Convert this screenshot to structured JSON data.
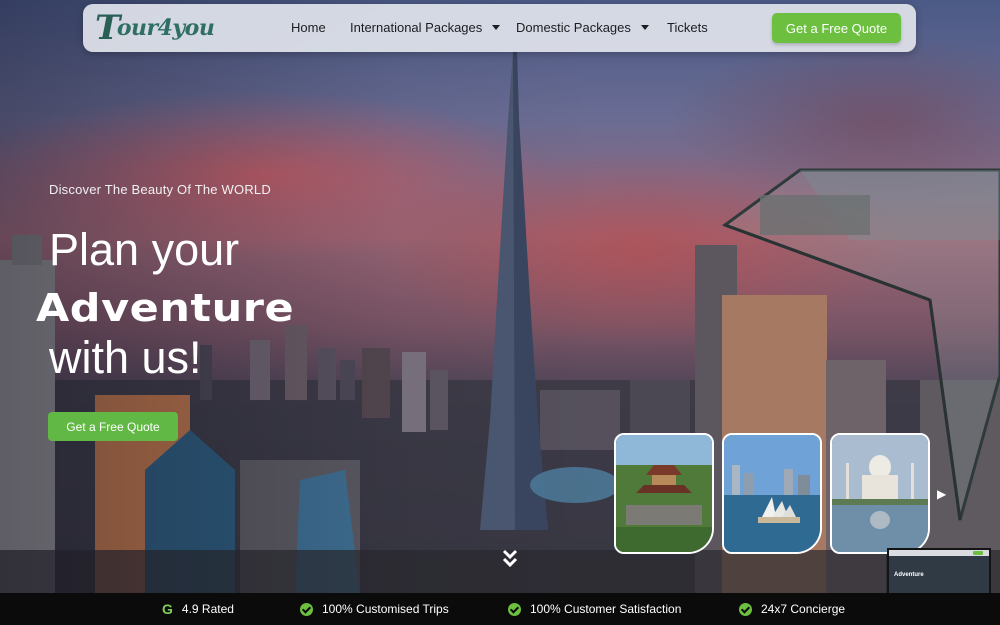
{
  "nav": {
    "logo_text": "our4you",
    "logo_mark": "T",
    "items": [
      {
        "label": "Home",
        "has_dropdown": false
      },
      {
        "label": "International Packages",
        "has_dropdown": true
      },
      {
        "label": "Domestic Packages",
        "has_dropdown": true
      },
      {
        "label": "Tickets",
        "has_dropdown": false
      }
    ],
    "cta_label": "Get a Free Quote"
  },
  "hero": {
    "tagline": "Discover The Beauty Of The WORLD",
    "headline_line1": "Plan your",
    "headline_line2": "Adventure",
    "headline_line3": "with us!",
    "cta_label": "Get a Free Quote"
  },
  "carousel": {
    "cards": [
      {
        "icon": "pagoda-garden-photo"
      },
      {
        "icon": "sydney-opera-house-photo"
      },
      {
        "icon": "taj-mahal-photo"
      }
    ],
    "next_icon": "chevron-right-icon"
  },
  "scroll_icon": "double-chevron-down-icon",
  "thumbnail": {
    "title": "Adventure"
  },
  "features": [
    {
      "icon": "google-g-icon",
      "label": "4.9 Rated"
    },
    {
      "icon": "check-circle-icon",
      "label": "100% Customised Trips"
    },
    {
      "icon": "check-circle-icon",
      "label": "100% Customer Satisfaction"
    },
    {
      "icon": "check-circle-icon",
      "label": "24x7 Concierge"
    }
  ],
  "colors": {
    "accent_green": "#6cbf3f",
    "logo_teal": "#2e6e63",
    "bottom_bar": "#0b0b0b"
  }
}
